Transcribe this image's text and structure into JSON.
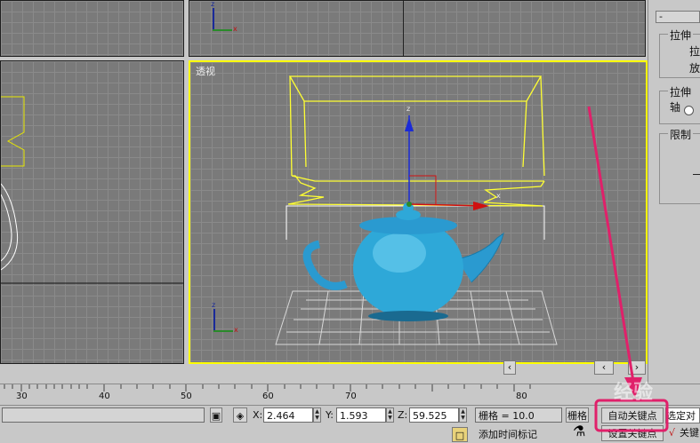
{
  "viewports": {
    "perspective_label": "透视"
  },
  "gizmo_labels": {
    "z": "z",
    "x": "x"
  },
  "command_panel": {
    "rollout_toggle": "-",
    "stretch_group": "拉伸",
    "stretch_field_1": "拉",
    "stretch_field_2": "放",
    "stretch_axis_group": "拉伸轴",
    "limit_group": "限制"
  },
  "time_ruler": {
    "ticks": [
      "30",
      "40",
      "50",
      "60",
      "70",
      "80"
    ]
  },
  "status_bar": {
    "x_label": "X:",
    "x_value": "2.464",
    "y_label": "Y:",
    "y_value": "1.593",
    "z_label": "Z:",
    "z_value": "59.525",
    "grid_label": "栅格 = 10.0",
    "grid_button": "栅格",
    "auto_key_button": "自动关键点",
    "selected_object_button": "选定对象",
    "set_key_button": "设置关键点",
    "key_filters_prefix": "关键",
    "add_time_tag": "添加时间标记"
  },
  "watermark": "经验",
  "colors": {
    "viewport_bg": "#7a7a7a",
    "active_viewport_border": "#ffff00",
    "highlight_arrow": "#e0206a",
    "teapot": "#2ea8d8"
  }
}
